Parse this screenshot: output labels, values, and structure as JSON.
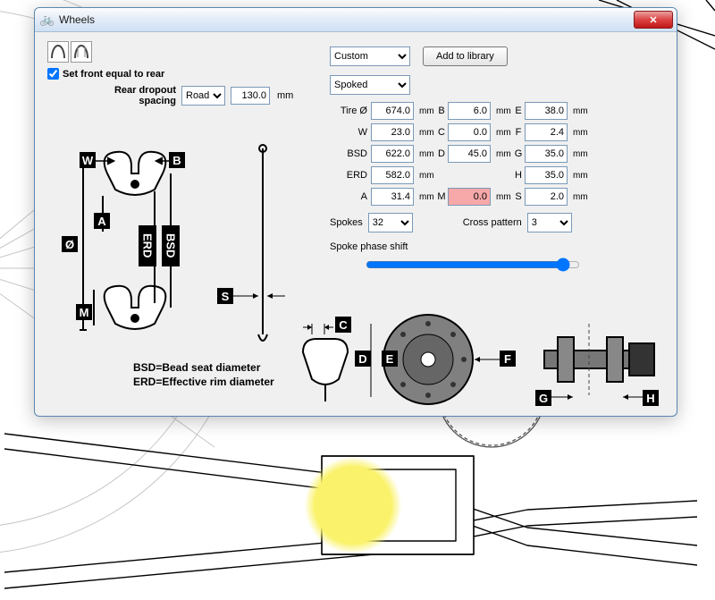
{
  "window": {
    "title": "Wheels"
  },
  "front_equal_rear": {
    "label": "Set front equal to rear",
    "checked": true
  },
  "rear_dropout": {
    "label": "Rear dropout spacing",
    "type_selected": "Road",
    "value": "130.0",
    "unit": "mm"
  },
  "library": {
    "preset_selected": "Custom",
    "add_label": "Add to library",
    "construction_selected": "Spoked"
  },
  "params": {
    "tire_d_label": "Tire Ø",
    "tire_d": "674.0",
    "w_label": "W",
    "w": "23.0",
    "bsd_label": "BSD",
    "bsd": "622.0",
    "erd_label": "ERD",
    "erd": "582.0",
    "a_label": "A",
    "a": "31.4",
    "b_label": "B",
    "b": "6.0",
    "c_label": "C",
    "c": "0.0",
    "d_label": "D",
    "d": "45.0",
    "m_label": "M",
    "m": "0.0",
    "e_label": "E",
    "e": "38.0",
    "f_label": "F",
    "f": "2.4",
    "g_label": "G",
    "g": "35.0",
    "h_label": "H",
    "h": "35.0",
    "s_label": "S",
    "s": "2.0",
    "unit": "mm"
  },
  "spokes": {
    "label": "Spokes",
    "value": "32",
    "cross_label": "Cross pattern",
    "cross_value": "3"
  },
  "phase": {
    "label": "Spoke phase shift"
  },
  "legend": {
    "line1": "BSD=Bead seat diameter",
    "line2": "ERD=Effective rim diameter"
  },
  "dia_labels": {
    "W": "W",
    "B": "B",
    "A": "A",
    "ERD": "ERD",
    "BSD": "BSD",
    "diam": "Ø",
    "M": "M",
    "S": "S",
    "C": "C",
    "D": "D",
    "E": "E",
    "F": "F",
    "G": "G",
    "H": "H"
  }
}
